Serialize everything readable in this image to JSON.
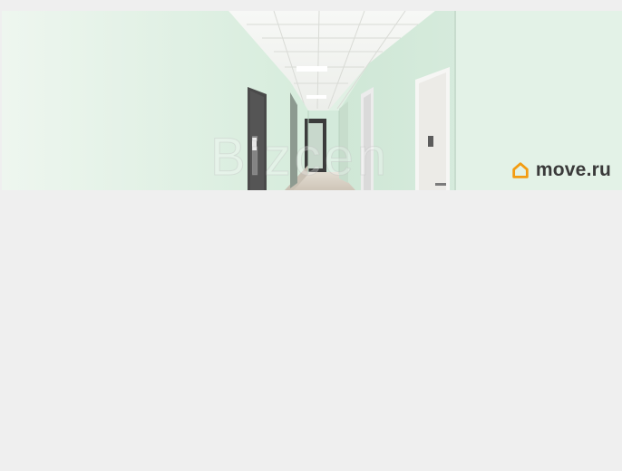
{
  "photo": {
    "subject": "corridor-photo",
    "watermark_text": "Bizcen",
    "logo_text": "move.ru",
    "logo_icon": "house-outline-icon",
    "logo_icon_color": "#f39c12",
    "logo_text_color": "#3a3a3a"
  },
  "colors": {
    "page_background": "#efefef",
    "wall": "#dcefe2",
    "ceiling": "#f2f4f1",
    "floor": "#d9d0c5",
    "door": "#4a4a4a"
  }
}
